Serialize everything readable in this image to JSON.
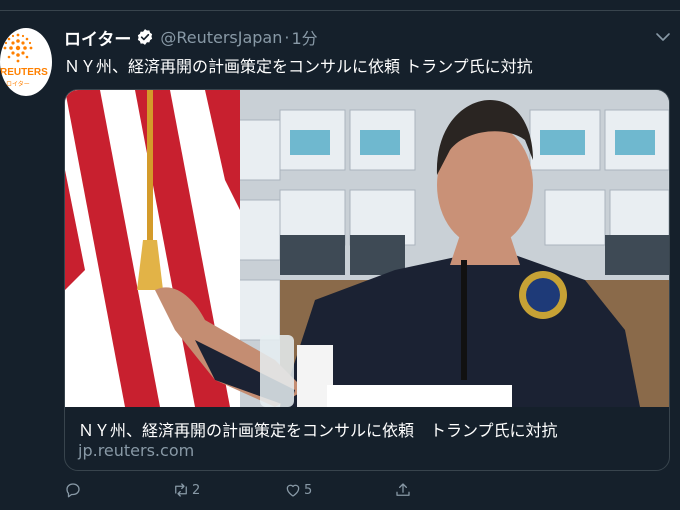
{
  "tweet": {
    "author_name": "ロイター",
    "handle": "@ReutersJapan",
    "separator": "·",
    "time": "1分",
    "text": "ＮＹ州、経済再開の計画策定をコンサルに依頼 トランプ氏に対抗",
    "verified": true
  },
  "avatar": {
    "brand": "REUTERS",
    "brand_sub": "ロイター",
    "brand_color": "#ff8000"
  },
  "card": {
    "title": "ＮＹ州、経済再開の計画策定をコンサルに依頼　トランプ氏に対抗",
    "domain": "jp.reuters.com"
  },
  "actions": {
    "reply_count": "",
    "retweet_count": "2",
    "like_count": "5"
  },
  "colors": {
    "background": "#15202b",
    "secondary_text": "#8899a6",
    "border": "#38444d",
    "verified": "#ffffff"
  }
}
